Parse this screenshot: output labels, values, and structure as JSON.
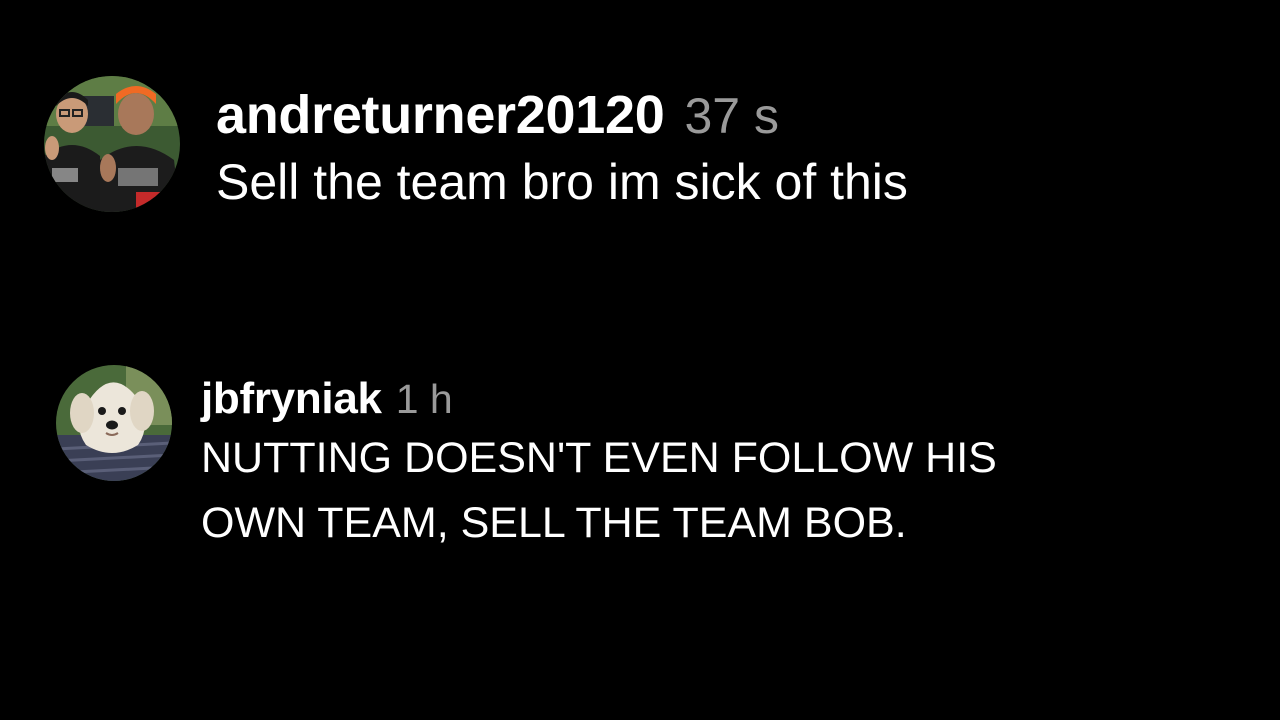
{
  "comments": [
    {
      "username": "andreturner20120",
      "timestamp": "37 s",
      "text": "Sell the team bro im sick of this",
      "avatar_icon": "profile-photo-two-people"
    },
    {
      "username": "jbfryniak",
      "timestamp": "1 h",
      "text": "NUTTING DOESN'T EVEN FOLLOW HIS OWN TEAM, SELL THE TEAM BOB.",
      "avatar_icon": "profile-photo-white-dog"
    }
  ],
  "colors": {
    "background": "#000000",
    "text": "#ffffff",
    "timestamp": "#9a9a9a"
  }
}
